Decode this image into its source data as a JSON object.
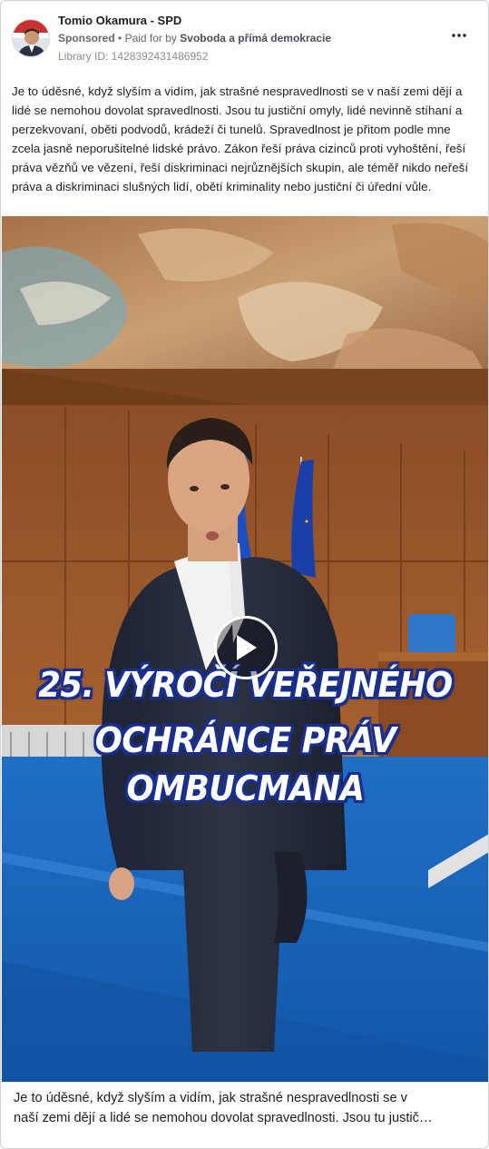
{
  "post": {
    "page_name": "Tomio Okamura - SPD",
    "sponsored_label": "Sponsored",
    "separator": "•",
    "paid_for_prefix": "Paid for by",
    "paid_for_by": "Svoboda a přímá demokracie",
    "library_id": "Library ID: 1428392431486952",
    "more_icon": "more-horizontal-icon",
    "body": "Je to úděsné, když slyším a vidím, jak strašné nespravedlnosti se v naší zemi dějí a lidé se nemohou dovolat spravedlnosti. Jsou tu justiční omyly, lidé nevinně stíhaní a perzekvovaní, oběti podvodů, krádeží či tunelů. Spravedlnost je přitom podle mne zcela jasně neporušitelné lidské právo. Zákon řeší práva cizinců proti vyhoštění, řeší práva vězňů ve vězení, řeší diskriminaci nejrůznějších skupin, ale téměř nikdo neřeší práva a diskriminaci slušných lidí, obětí kriminality nebo justiční či úřední vůle."
  },
  "video": {
    "overlay_line1": "25. VÝROČÍ VEŘEJNÉHO",
    "overlay_line2": "OCHRÁNCE PRÁV",
    "overlay_line3": "OMBUCMANA",
    "play_icon": "play-icon",
    "overlay_outline_color": "#1a2f8c"
  },
  "caption": {
    "line1": "Je to úděsné, když slyším a vidím, jak strašné nespravedlnosti se v",
    "line2": "naší zemi dějí a lidé se nemohou dovolat spravedlnosti. Jsou tu justič…"
  }
}
